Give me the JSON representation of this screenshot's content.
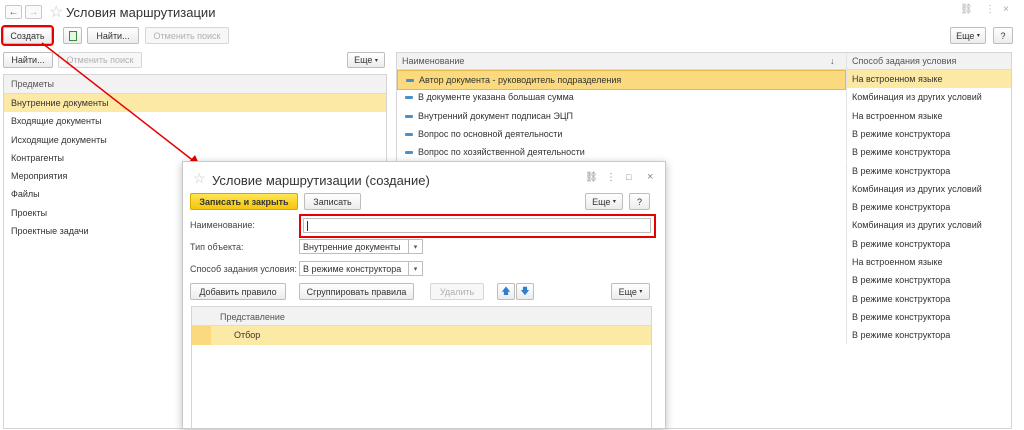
{
  "main": {
    "title": "Условия маршрутизации",
    "toolbar": {
      "create": "Создать",
      "find": "Найти...",
      "cancel_search": "Отменить поиск",
      "more": "Еще",
      "help": "?"
    },
    "left": {
      "find": "Найти...",
      "cancel_search": "Отменить поиск",
      "more": "Еще",
      "header": "Предметы",
      "items": [
        "Внутренние документы",
        "Входящие документы",
        "Исходящие документы",
        "Контрагенты",
        "Мероприятия",
        "Файлы",
        "Проекты",
        "Проектные задачи"
      ]
    },
    "table": {
      "col_name": "Наименование",
      "col_method": "Способ задания условия",
      "sort_indicator": "↓",
      "rows": [
        {
          "name": "Автор документа - руководитель подразделения",
          "method": "На встроенном языке"
        },
        {
          "name": "В документе указана большая сумма",
          "method": "Комбинация из других условий"
        },
        {
          "name": "Внутренний документ подписан ЭЦП",
          "method": "На встроенном языке"
        },
        {
          "name": "Вопрос по основной деятельности",
          "method": "В режиме конструктора"
        },
        {
          "name": "Вопрос по хозяйственной деятельности",
          "method": "В режиме конструктора"
        },
        {
          "name": "",
          "method": "В режиме конструктора"
        },
        {
          "name": "",
          "method": "Комбинация из других условий"
        },
        {
          "name": "",
          "method": "В режиме конструктора"
        },
        {
          "name": "",
          "method": "Комбинация из других условий"
        },
        {
          "name": "",
          "method": "В режиме конструктора"
        },
        {
          "name": "",
          "method": "На встроенном языке"
        },
        {
          "name": "",
          "method": "В режиме конструктора"
        },
        {
          "name": "",
          "method": "В режиме конструктора"
        },
        {
          "name": "",
          "method": "В режиме конструктора"
        },
        {
          "name": "",
          "method": "В режиме конструктора"
        }
      ]
    }
  },
  "dialog": {
    "title": "Условие маршрутизации (создание)",
    "save_close": "Записать и закрыть",
    "save": "Записать",
    "more": "Еще",
    "help": "?",
    "name_label": "Наименование:",
    "name_value": "",
    "type_label": "Тип объекта:",
    "type_value": "Внутренние документы",
    "method_label": "Способ задания условия:",
    "method_value": "В режиме конструктора",
    "add_rule": "Добавить правило",
    "group_rules": "Сгруппировать правила",
    "delete": "Удалить",
    "more2": "Еще",
    "grid_header": "Представление",
    "grid_row": "Отбор"
  },
  "colors": {
    "highlight": "#e60000",
    "selection": "#fde9a6",
    "primary": "#f5c60c"
  }
}
